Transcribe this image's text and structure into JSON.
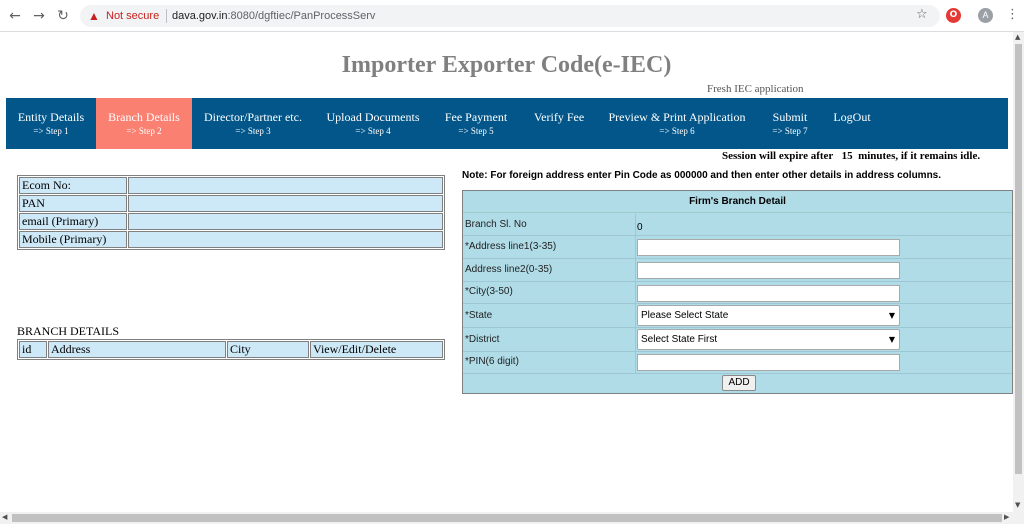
{
  "browser": {
    "security_label": "Not secure",
    "url_host": "dava.gov.in",
    "url_rest": ":8080/dgftiec/PanProcessServ",
    "avatar_letter": "A"
  },
  "header": {
    "title": "Importer Exporter Code(e-IEC)",
    "subtitle": "Fresh IEC application"
  },
  "nav": {
    "items": [
      {
        "label": "Entity Details",
        "step": "=> Step 1"
      },
      {
        "label": "Branch Details",
        "step": "=> Step 2"
      },
      {
        "label": "Director/Partner etc.",
        "step": "=> Step 3"
      },
      {
        "label": "Upload Documents",
        "step": "=> Step 4"
      },
      {
        "label": "Fee Payment",
        "step": "=> Step 5"
      },
      {
        "label": "Verify Fee",
        "step": ""
      },
      {
        "label": "Preview & Print Application",
        "step": "=> Step 6"
      },
      {
        "label": "Submit",
        "step": "=> Step 7"
      },
      {
        "label": "LogOut",
        "step": ""
      }
    ]
  },
  "session": {
    "prefix": "Session will expire after",
    "minutes": "15",
    "suffix": "minutes, if it remains idle."
  },
  "info": {
    "rows": [
      {
        "label": "Ecom No:",
        "value": ""
      },
      {
        "label": "PAN",
        "value": ""
      },
      {
        "label": "email (Primary)",
        "value": ""
      },
      {
        "label": "Mobile (Primary)",
        "value": ""
      }
    ]
  },
  "branches": {
    "caption": "BRANCH DETAILS",
    "columns": [
      "id",
      "Address",
      "City",
      "View/Edit/Delete"
    ]
  },
  "note": "Note: For foreign address enter Pin Code as 000000 and then enter other details in address columns.",
  "form": {
    "title": "Firm's Branch Detail",
    "branch_sl_label": "Branch Sl. No",
    "branch_sl_value": "0",
    "address1_label": "*Address line1(3-35)",
    "address2_label": "Address line2(0-35)",
    "city_label": "*City(3-50)",
    "state_label": "*State",
    "state_value": "Please Select State",
    "district_label": "*District",
    "district_value": "Select State First",
    "pin_label": "*PIN(6 digit)",
    "add_label": "ADD"
  }
}
